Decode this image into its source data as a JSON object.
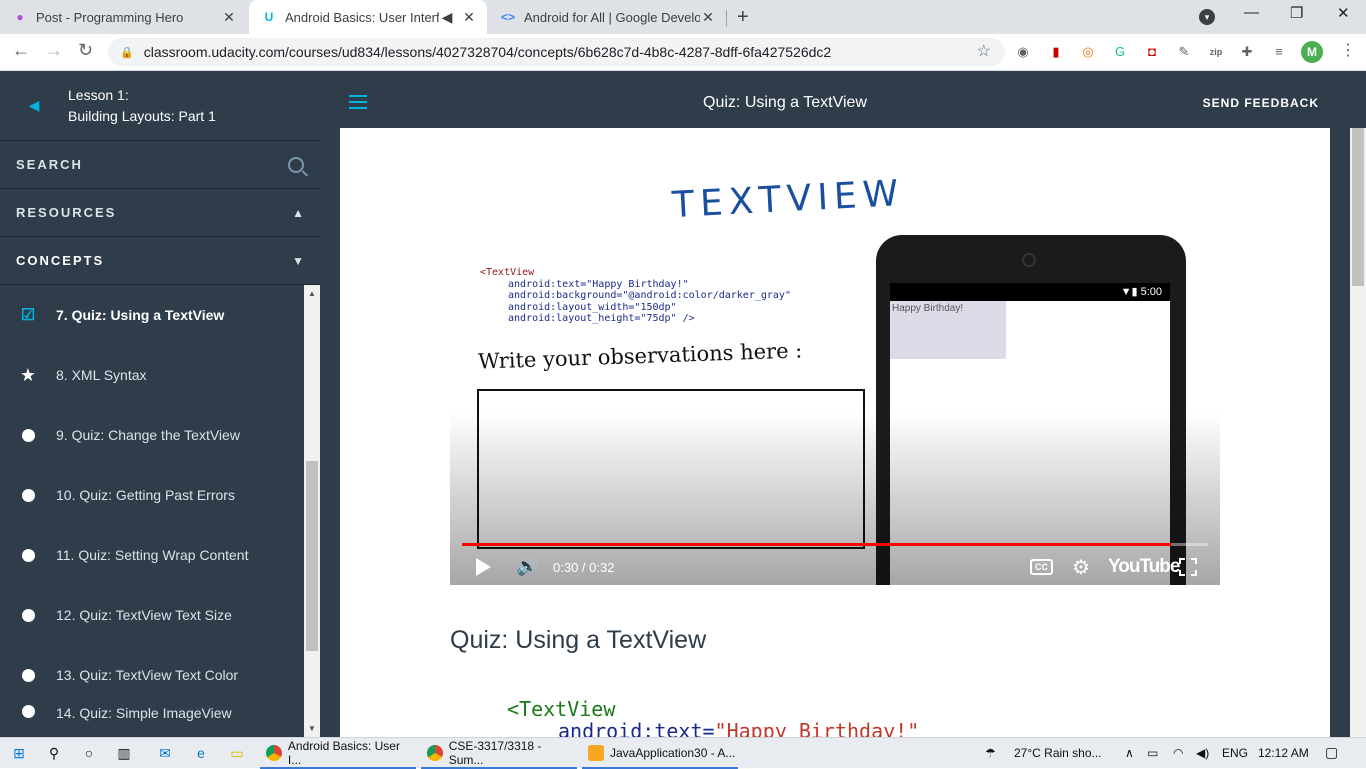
{
  "browser": {
    "tabs": [
      {
        "title": "Post - Programming Hero",
        "active": false
      },
      {
        "title": "Android Basics: User Interfac",
        "active": true
      },
      {
        "title": "Android for All  |  Google Develo",
        "active": false
      }
    ],
    "url": "classroom.udacity.com/courses/ud834/lessons/4027328704/concepts/6b628c7d-4b8c-4287-8dff-6fa427526dc2",
    "profile_initial": "M",
    "accent_color": "#02b3e4"
  },
  "sidebar": {
    "lesson_line1": "Lesson 1:",
    "lesson_line2": "Building Layouts: Part 1",
    "search_label": "SEARCH",
    "resources_label": "RESOURCES",
    "concepts_label": "CONCEPTS",
    "concepts": [
      {
        "label": "7. Quiz: Using a TextView",
        "icon": "check-icon",
        "active": true
      },
      {
        "label": "8. XML Syntax",
        "icon": "star-icon",
        "active": false
      },
      {
        "label": "9. Quiz: Change the TextView",
        "icon": "dot-icon",
        "active": false
      },
      {
        "label": "10. Quiz: Getting Past Errors",
        "icon": "dot-icon",
        "active": false
      },
      {
        "label": "11. Quiz: Setting Wrap Content",
        "icon": "dot-icon",
        "active": false
      },
      {
        "label": "12. Quiz: TextView Text Size",
        "icon": "dot-icon",
        "active": false
      },
      {
        "label": "13. Quiz: TextView Text Color",
        "icon": "dot-icon",
        "active": false
      },
      {
        "label": "14. Quiz: Simple ImageView",
        "icon": "dot-icon",
        "active": false
      }
    ]
  },
  "header": {
    "title": "Quiz: Using a TextView",
    "feedback": "SEND FEEDBACK"
  },
  "video": {
    "heading": "TEXTVIEW",
    "code_lines": [
      "<TextView",
      "android:text=\"Happy Birthday!\"",
      "android:background=\"@android:color/darker_gray\"",
      "android:layout_width=\"150dp\"",
      "android:layout_height=\"75dp\" />"
    ],
    "observation_prompt": "Write your observations here :",
    "phone_time": "5:00",
    "phone_text": "Happy Birthday!",
    "time": "0:30 / 0:32",
    "progress": 0.951,
    "brand": "YouTube",
    "cc": "CC"
  },
  "content": {
    "heading": "Quiz: Using a TextView",
    "code_tag": "<TextView",
    "code_attr": "android:text=",
    "code_value": "\"Happy Birthday!\""
  },
  "taskbar": {
    "apps": [
      "Android Basics: User I...",
      "CSE-3317/3318 - Sum...",
      "JavaApplication30 - A..."
    ],
    "weather": "27°C  Rain sho...",
    "lang": "ENG",
    "clock": "12:12 AM"
  }
}
